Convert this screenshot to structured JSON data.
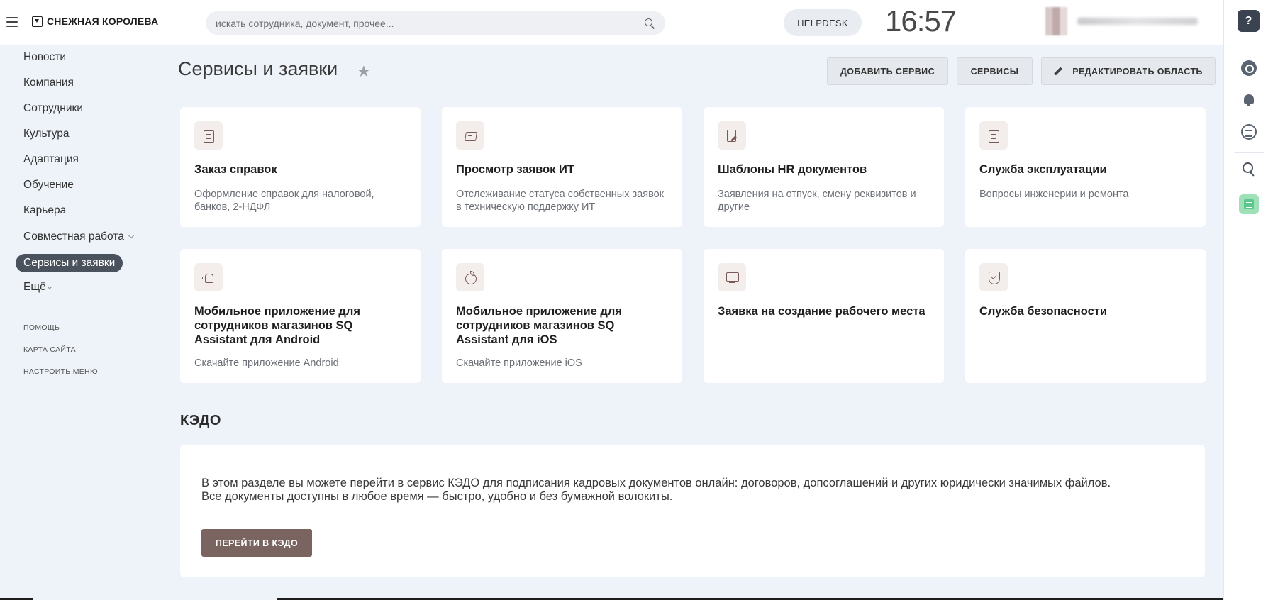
{
  "header": {
    "logo_text": "СНЕЖНАЯ КОРОЛЕВА",
    "search_placeholder": "искать сотрудника, документ, прочее...",
    "helpdesk_label": "HELPDESK",
    "clock": "16:57"
  },
  "sidebar": {
    "items": [
      {
        "label": "Новости"
      },
      {
        "label": "Компания"
      },
      {
        "label": "Сотрудники"
      },
      {
        "label": "Культура"
      },
      {
        "label": "Адаптация"
      },
      {
        "label": "Обучение"
      },
      {
        "label": "Карьера"
      },
      {
        "label": "Совместная работа"
      },
      {
        "label": "Сервисы и заявки"
      },
      {
        "label": "Ещё"
      }
    ],
    "aux_links": [
      "ПОМОЩЬ",
      "КАРТА САЙТА",
      "НАСТРОИТЬ МЕНЮ"
    ]
  },
  "main": {
    "title": "Сервисы и заявки",
    "buttons": {
      "add_service": "ДОБАВИТЬ СЕРВИС",
      "services": "СЕРВИСЫ",
      "edit_area": "РЕДАКТИРОВАТЬ ОБЛАСТЬ"
    },
    "cards": [
      {
        "icon": "clipboard-icon",
        "title": "Заказ справок",
        "desc": "Оформление справок для налоговой, банков, 2-НДФЛ"
      },
      {
        "icon": "ticket-icon",
        "title": "Просмотр заявок ИТ",
        "desc": "Отслеживание статуса собственных заявок в техническую поддержку ИТ"
      },
      {
        "icon": "document-edit-icon",
        "title": "Шаблоны HR документов",
        "desc": "Заявления на отпуск, смену реквизитов и другие"
      },
      {
        "icon": "clipboard-icon",
        "title": "Служба эксплуатации",
        "desc": "Вопросы инженерии и ремонта"
      },
      {
        "icon": "android-icon",
        "title": "Мобильное приложение для сотрудников магазинов SQ Assistant для Android",
        "desc": "Скачайте приложение Android"
      },
      {
        "icon": "apple-icon",
        "title": "Мобильное приложение для сотрудников магазинов SQ Assistant для iOS",
        "desc": "Скачайте приложение iOS"
      },
      {
        "icon": "monitor-icon",
        "title": "Заявка на создание рабочего места",
        "desc": ""
      },
      {
        "icon": "shield-icon",
        "title": "Служба безопасности",
        "desc": ""
      }
    ],
    "kedo": {
      "title": "КЭДО",
      "text_line1": "В этом разделе вы можете перейти в сервис КЭДО для подписания кадровых документов онлайн: договоров, допсоглашений и других юридически значимых файлов.",
      "text_line2": "Все документы доступны в любое время — быстро, удобно и без бумажной волокиты.",
      "button": "ПЕРЕЙТИ В КЭДО"
    }
  },
  "rail": {
    "help_label": "?"
  },
  "colors": {
    "accent": "#7a6460",
    "active_nav": "#4a525d",
    "background": "#eef3fa"
  }
}
